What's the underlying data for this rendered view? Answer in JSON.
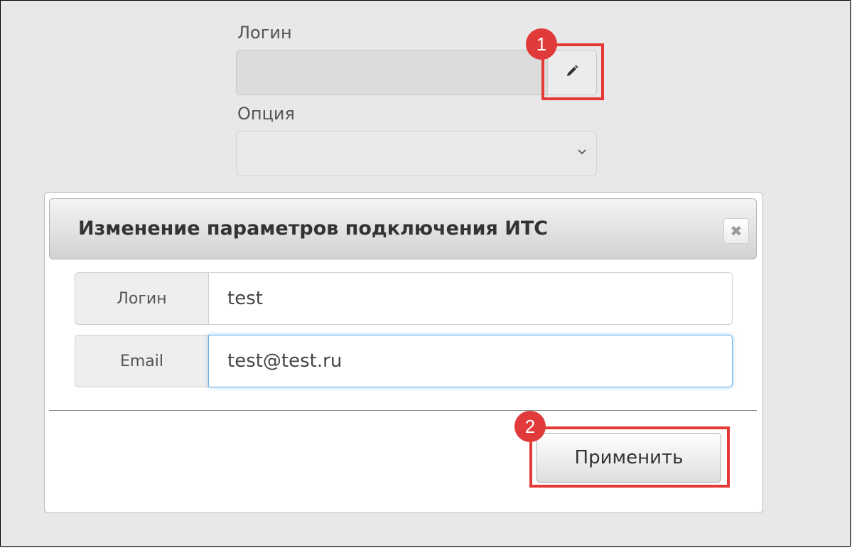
{
  "top_form": {
    "login_label": "Логин",
    "option_label": "Опция",
    "edit_icon": "pencil-icon",
    "select_icon": "chevron-down-icon"
  },
  "markers": {
    "one": "1",
    "two": "2"
  },
  "dialog": {
    "title": "Изменение параметров подключения ИТС",
    "close_icon": "close-icon",
    "fields": [
      {
        "label": "Логин",
        "value": "test"
      },
      {
        "label": "Email",
        "value": "test@test.ru"
      }
    ],
    "apply_label": "Применить"
  },
  "colors": {
    "highlight": "#e53935",
    "marker": "#e03a3a",
    "focus": "#66afe9"
  }
}
